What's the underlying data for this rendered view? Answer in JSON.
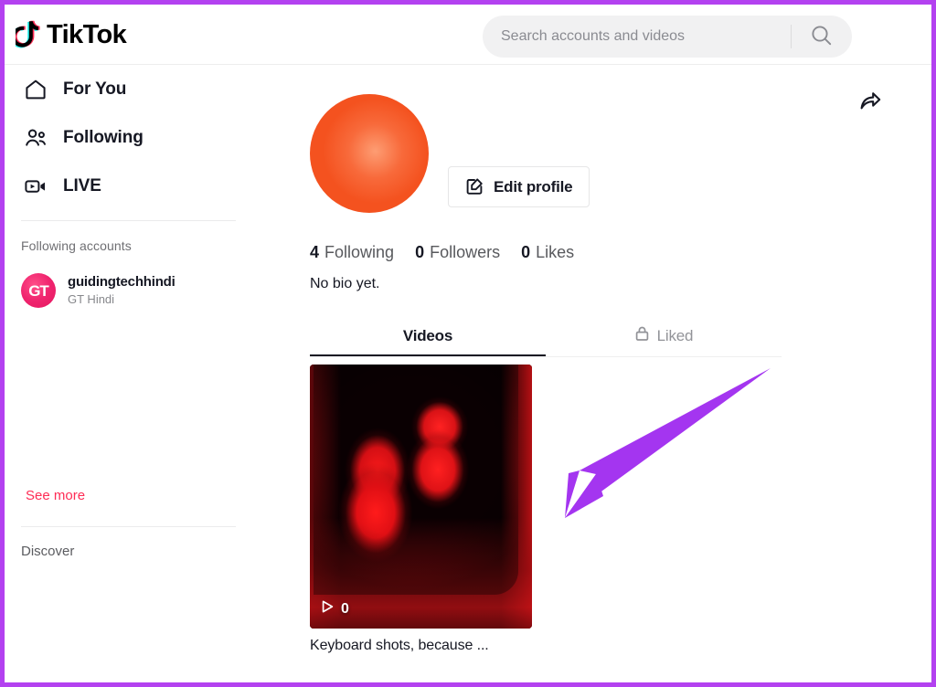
{
  "header": {
    "brand_name": "TikTok",
    "logo_icon": "tiktok-note-icon",
    "search": {
      "placeholder": "Search accounts and videos",
      "value": "",
      "icon": "search-icon"
    }
  },
  "sidebar": {
    "nav_items": [
      {
        "label": "For You",
        "icon": "home-icon"
      },
      {
        "label": "Following",
        "icon": "people-icon"
      },
      {
        "label": "LIVE",
        "icon": "live-video-icon"
      }
    ],
    "following_heading": "Following accounts",
    "accounts": [
      {
        "username": "guidingtechhindi",
        "nickname": "GT Hindi",
        "avatar_text": "GT"
      }
    ],
    "see_more_label": "See more",
    "discover_heading": "Discover"
  },
  "profile": {
    "avatar_name": "profile-avatar",
    "share_icon": "share-arrow-icon",
    "edit_button": {
      "label": "Edit profile",
      "icon": "edit-pencil-icon"
    },
    "stats": [
      {
        "count": "4",
        "label": "Following"
      },
      {
        "count": "0",
        "label": "Followers"
      },
      {
        "count": "0",
        "label": "Likes"
      }
    ],
    "bio": "No bio yet."
  },
  "tabs": [
    {
      "label": "Videos",
      "active": true,
      "icon": null
    },
    {
      "label": "Liked",
      "active": false,
      "icon": "lock-icon"
    }
  ],
  "videos": [
    {
      "caption": "Keyboard shots, because ...",
      "play_count": "0",
      "play_icon": "play-triangle-icon"
    }
  ],
  "annotation": {
    "arrow_color": "#a435f0",
    "border_color": "#b341f0"
  },
  "colors": {
    "accent_pink": "#fe2c55",
    "accent_cyan": "#25f4ee",
    "text_primary": "#161823",
    "text_secondary": "#86878b",
    "search_bg": "#f1f1f2"
  }
}
